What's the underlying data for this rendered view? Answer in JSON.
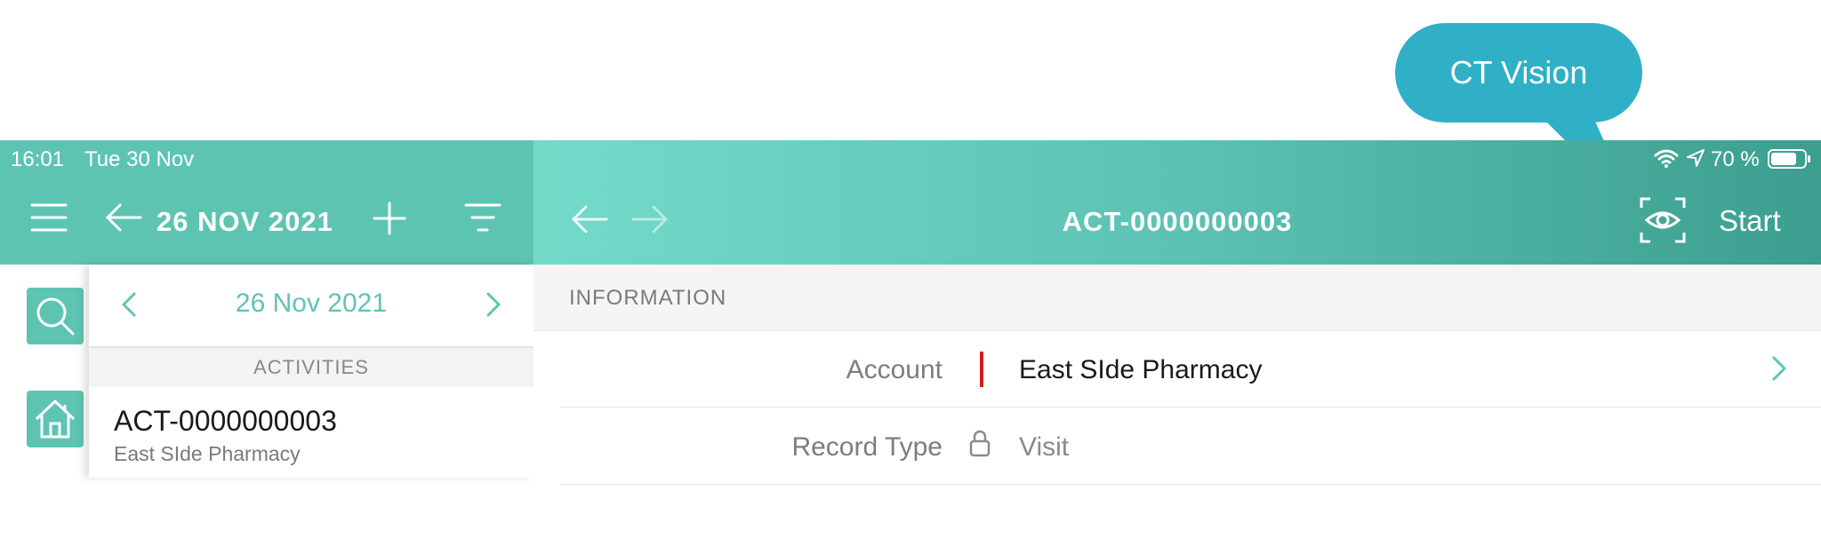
{
  "tooltip": {
    "text": "CT Vision"
  },
  "status_bar": {
    "time": "16:01",
    "date": "Tue 30 Nov",
    "battery": "70 %"
  },
  "left_nav": {
    "title": "26 NOV 2021"
  },
  "right_nav": {
    "title": "ACT-0000000003",
    "start_label": "Start"
  },
  "date_picker": {
    "date": "26 Nov 2021"
  },
  "list": {
    "section_header": "ACTIVITIES",
    "items": [
      {
        "title": "ACT-0000000003",
        "subtitle": "East SIde Pharmacy"
      }
    ]
  },
  "detail": {
    "section_header": "INFORMATION",
    "fields": [
      {
        "label": "Account",
        "value": "East SIde Pharmacy"
      },
      {
        "label": "Record Type",
        "value": "Visit"
      }
    ]
  },
  "colors": {
    "accent": "#5ec4b2",
    "tooltip": "#30b0c7",
    "required_marker": "#d0201e"
  }
}
